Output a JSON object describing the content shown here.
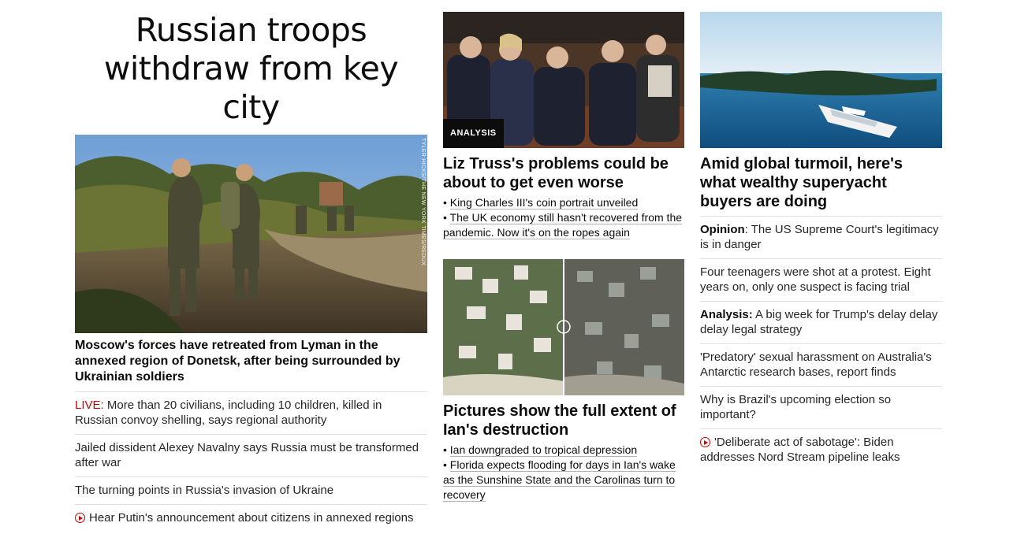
{
  "left": {
    "headline": "Russian troops withdraw from key city",
    "image_credit": "TYLER HICKS/THE NEW YORK TIMES/REDUX",
    "caption": "Moscow's forces have retreated from Lyman in the annexed region of Donetsk, after being surrounded by Ukrainian soldiers",
    "items": [
      {
        "prefix": "LIVE:",
        "text": " More than 20 civilians, including 10 children, killed in Russian convoy shelling, says regional authority"
      },
      {
        "text": "Jailed dissident Alexey Navalny says Russia must be transformed after war"
      },
      {
        "text": "The turning points in Russia's invasion of Ukraine"
      },
      {
        "icon": "play-icon",
        "text": "Hear Putin's announcement about citizens in annexed regions"
      }
    ]
  },
  "middle": {
    "story1": {
      "badge": "ANALYSIS",
      "headline": "Liz Truss's problems could be about to get even worse",
      "links": [
        "King Charles III's coin portrait unveiled",
        "The UK economy still hasn't recovered from the pandemic. Now it's on the ropes again"
      ]
    },
    "story2": {
      "headline": "Pictures show the full extent of Ian's destruction",
      "links": [
        "Ian downgraded to tropical depression",
        "Florida expects flooding for days in Ian's wake as the Sunshine State and the Carolinas turn to recovery"
      ]
    }
  },
  "right": {
    "headline": "Amid global turmoil, here's what wealthy superyacht buyers are doing",
    "items": [
      {
        "lead": "Opinion",
        "text": ": The US Supreme Court's legitimacy is in danger"
      },
      {
        "text": "Four teenagers were shot at a protest. Eight years on, only one suspect is facing trial"
      },
      {
        "lead": "Analysis:",
        "text": " A big week for Trump's delay delay delay legal strategy"
      },
      {
        "text": "'Predatory' sexual harassment on Australia's Antarctic research bases, report finds"
      },
      {
        "text": "Why is Brazil's upcoming election so important?"
      },
      {
        "icon": "play-icon",
        "text": "'Deliberate act of sabotage': Biden addresses Nord Stream pipeline leaks"
      }
    ]
  },
  "colors": {
    "live": "#cc0000",
    "text": "#0c0c0c",
    "divider": "#e0e0e0"
  }
}
